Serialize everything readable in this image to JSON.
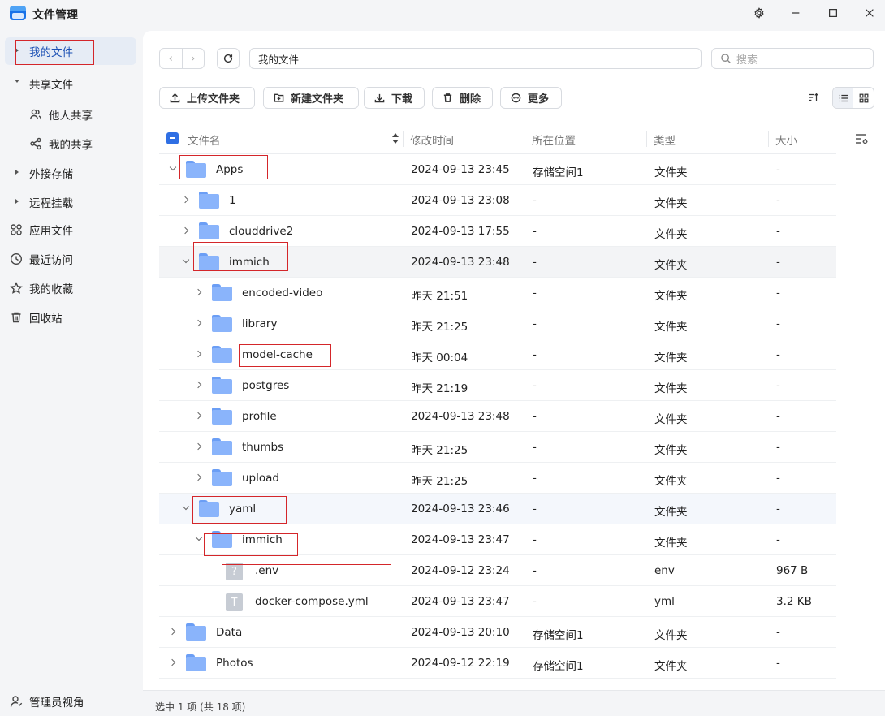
{
  "window": {
    "title": "文件管理",
    "icons": [
      "gear-icon",
      "minimize-icon",
      "maximize-icon",
      "close-icon"
    ]
  },
  "sidebar": {
    "items": [
      {
        "label": "我的文件"
      },
      {
        "label": "共享文件"
      },
      {
        "label": "他人共享"
      },
      {
        "label": "我的共享"
      },
      {
        "label": "外接存储"
      },
      {
        "label": "远程挂载"
      },
      {
        "label": "应用文件"
      },
      {
        "label": "最近访问"
      },
      {
        "label": "我的收藏"
      },
      {
        "label": "回收站"
      }
    ],
    "footer": "管理员视角"
  },
  "address": {
    "back": "‹",
    "forward": "›",
    "path": "我的文件",
    "search_placeholder": "搜索"
  },
  "toolbar": {
    "upload": "上传文件夹",
    "new_folder": "新建文件夹",
    "download": "下载",
    "delete": "删除",
    "more": "更多"
  },
  "columns": {
    "name": "文件名",
    "time": "修改时间",
    "location": "所在位置",
    "type": "类型",
    "size": "大小"
  },
  "rows": [
    {
      "name": "Apps",
      "time": "2024-09-13 23:45",
      "location": "存储空间1",
      "type": "文件夹",
      "size": "-"
    },
    {
      "name": "1",
      "time": "2024-09-13 23:08",
      "location": "-",
      "type": "文件夹",
      "size": "-"
    },
    {
      "name": "clouddrive2",
      "time": "2024-09-13 17:55",
      "location": "-",
      "type": "文件夹",
      "size": "-"
    },
    {
      "name": "immich",
      "time": "2024-09-13 23:48",
      "location": "-",
      "type": "文件夹",
      "size": "-"
    },
    {
      "name": "encoded-video",
      "time": "昨天 21:51",
      "location": "-",
      "type": "文件夹",
      "size": "-"
    },
    {
      "name": "library",
      "time": "昨天 21:25",
      "location": "-",
      "type": "文件夹",
      "size": "-"
    },
    {
      "name": "model-cache",
      "time": "昨天 00:04",
      "location": "-",
      "type": "文件夹",
      "size": "-"
    },
    {
      "name": "postgres",
      "time": "昨天 21:19",
      "location": "-",
      "type": "文件夹",
      "size": "-"
    },
    {
      "name": "profile",
      "time": "2024-09-13 23:48",
      "location": "-",
      "type": "文件夹",
      "size": "-"
    },
    {
      "name": "thumbs",
      "time": "昨天 21:25",
      "location": "-",
      "type": "文件夹",
      "size": "-"
    },
    {
      "name": "upload",
      "time": "昨天 21:25",
      "location": "-",
      "type": "文件夹",
      "size": "-"
    },
    {
      "name": "yaml",
      "time": "2024-09-13 23:46",
      "location": "-",
      "type": "文件夹",
      "size": "-"
    },
    {
      "name": "immich",
      "time": "2024-09-13 23:47",
      "location": "-",
      "type": "文件夹",
      "size": "-"
    },
    {
      "name": ".env",
      "time": "2024-09-12 23:24",
      "location": "-",
      "type": "env",
      "size": "967 B",
      "glyph": "?"
    },
    {
      "name": "docker-compose.yml",
      "time": "2024-09-13 23:47",
      "location": "-",
      "type": "yml",
      "size": "3.2 KB",
      "glyph": "T"
    },
    {
      "name": "Data",
      "time": "2024-09-13 20:10",
      "location": "存储空间1",
      "type": "文件夹",
      "size": "-"
    },
    {
      "name": "Photos",
      "time": "2024-09-12 22:19",
      "location": "存储空间1",
      "type": "文件夹",
      "size": "-"
    }
  ],
  "status": "选中 1 项 (共 18 项)"
}
